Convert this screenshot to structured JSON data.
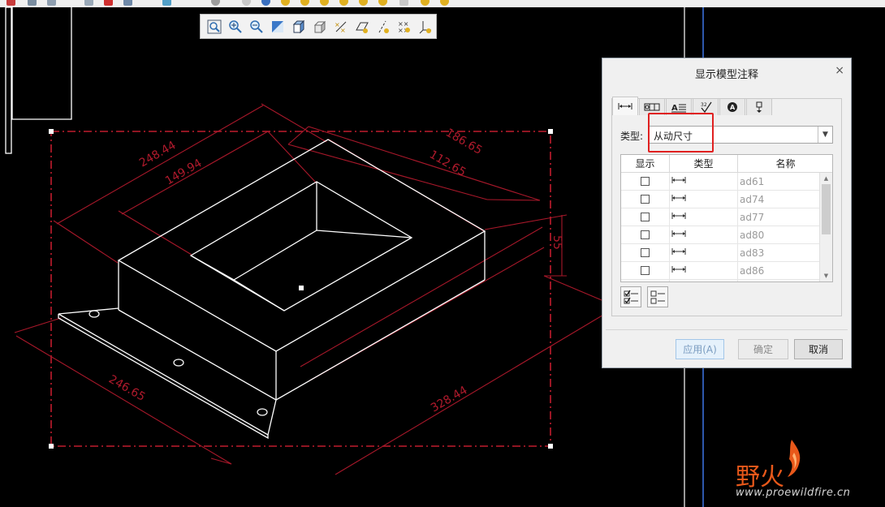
{
  "colors": {
    "background": "#000000",
    "model_edges": "#ffffff",
    "dimensions": "#b8192d",
    "accent_highlight": "#e02020",
    "watermark": "#e8581a"
  },
  "view_toolbar": {
    "icons": [
      "zoom-fit-icon",
      "zoom-in-icon",
      "zoom-out-icon",
      "repaint-icon",
      "orientation-cube-icon",
      "display-style-icon",
      "datum-display-icon",
      "plane-display-icon",
      "axis-display-icon",
      "point-display-icon",
      "csys-display-icon"
    ]
  },
  "dimensions": {
    "d_248": "248.44",
    "d_149": "149.94",
    "d_186": "186.65",
    "d_112": "112.65",
    "d_55": "55",
    "d_246": "246.65",
    "d_328": "328.44"
  },
  "dialog": {
    "title": "显示模型注释",
    "close_glyph": "×",
    "tabs": [
      "dimension-tab-icon",
      "gtol-tab-icon",
      "note-tab-icon",
      "surface-finish-tab-icon",
      "symbol-tab-icon",
      "datum-target-tab-icon"
    ],
    "type_label": "类型:",
    "type_value": "从动尺寸",
    "table": {
      "headers": {
        "show": "显示",
        "type": "类型",
        "name": "名称"
      },
      "rows": [
        {
          "name": "ad61"
        },
        {
          "name": "ad74"
        },
        {
          "name": "ad77"
        },
        {
          "name": "ad80"
        },
        {
          "name": "ad83"
        },
        {
          "name": "ad86"
        }
      ]
    },
    "buttons": {
      "apply": "应用(A)",
      "ok": "确定",
      "cancel": "取消"
    }
  },
  "watermark": {
    "text": "野火",
    "url": "www.proewildfire.cn"
  }
}
